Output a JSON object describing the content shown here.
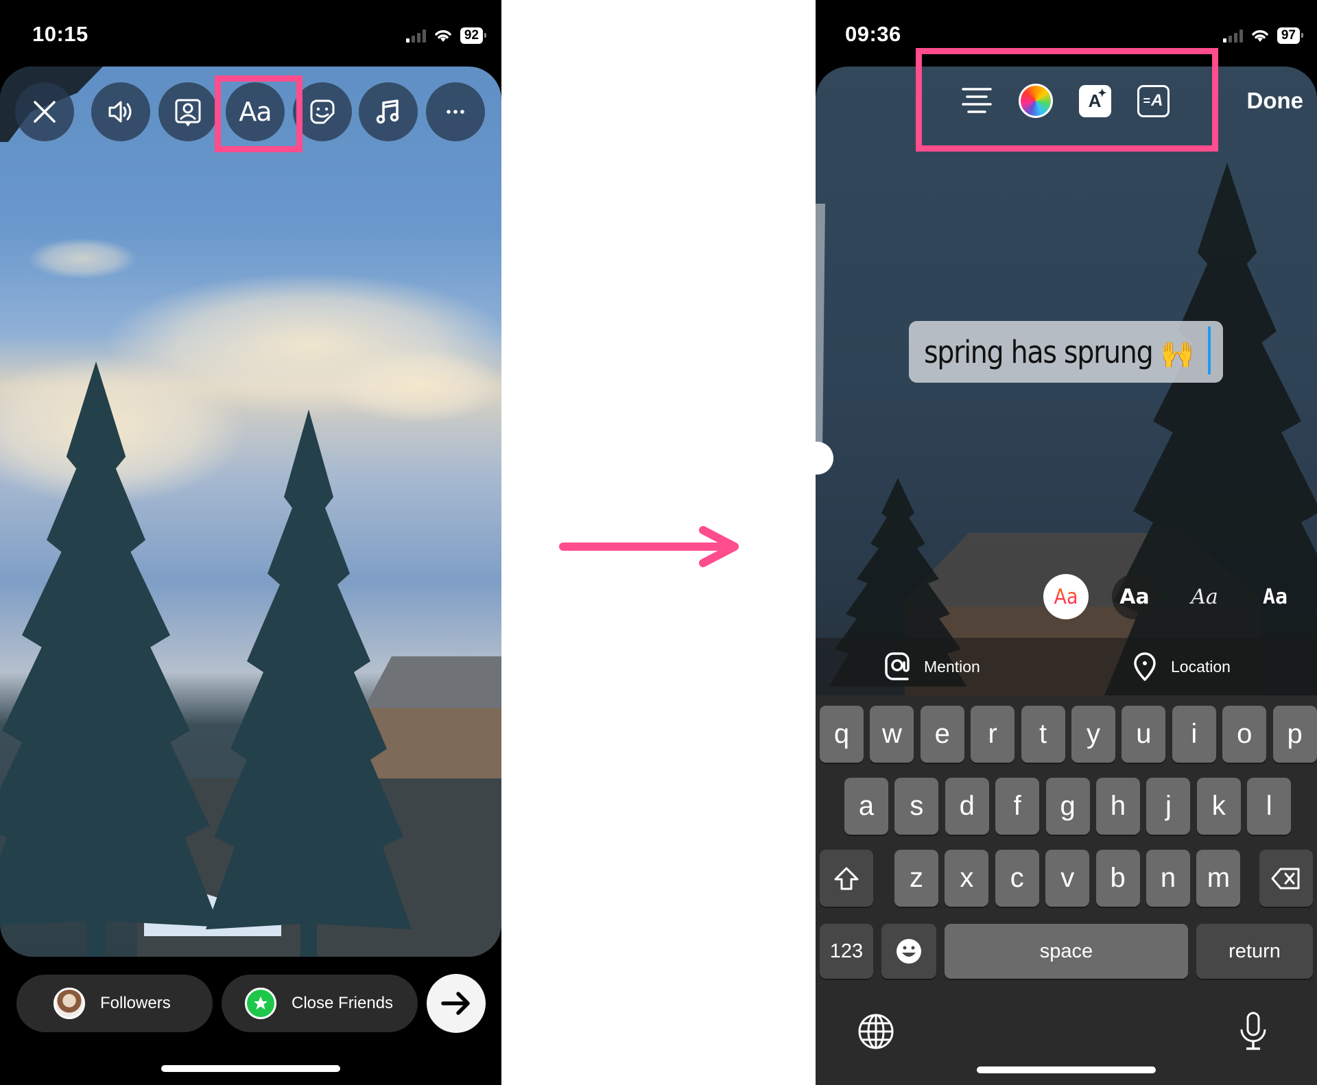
{
  "left_screen": {
    "status_bar": {
      "time": "10:15",
      "battery": "92"
    },
    "toolbar": {
      "buttons": [
        {
          "name": "close",
          "icon": "close-icon"
        },
        {
          "name": "sound",
          "icon": "speaker-icon"
        },
        {
          "name": "mention-person",
          "icon": "person-tag-icon"
        },
        {
          "name": "text",
          "icon": "text-aa-icon",
          "label": "Aa",
          "highlighted": true
        },
        {
          "name": "sticker",
          "icon": "sticker-icon"
        },
        {
          "name": "music",
          "icon": "music-note-icon"
        },
        {
          "name": "more",
          "icon": "more-dots-icon"
        }
      ]
    },
    "share_bar": {
      "followers_label": "Followers",
      "close_friends_label": "Close Friends",
      "next_icon": "arrow-right-icon"
    }
  },
  "transition_arrow": {
    "color": "#ff4d8d"
  },
  "right_screen": {
    "status_bar": {
      "time": "09:36",
      "battery": "97"
    },
    "text_tools": {
      "icons": [
        "align-center-icon",
        "color-wheel-icon",
        "text-effects-icon",
        "text-animation-icon"
      ],
      "effects_label": "A",
      "animation_label": "A",
      "done_label": "Done"
    },
    "story_text": {
      "value": "spring has sprung",
      "emoji": "🙌"
    },
    "font_styles": [
      {
        "label": "Aa",
        "style": "classic",
        "selected": true
      },
      {
        "label": "Aa",
        "style": "strong",
        "selected": false
      },
      {
        "label": "Aa",
        "style": "script",
        "selected": false
      },
      {
        "label": "Aa",
        "style": "typewriter",
        "selected": false
      }
    ],
    "suggestions": {
      "mention_label": "Mention",
      "location_label": "Location"
    },
    "keyboard": {
      "row1": [
        "q",
        "w",
        "e",
        "r",
        "t",
        "y",
        "u",
        "i",
        "o",
        "p"
      ],
      "row2": [
        "a",
        "s",
        "d",
        "f",
        "g",
        "h",
        "j",
        "k",
        "l"
      ],
      "row3": [
        "z",
        "x",
        "c",
        "v",
        "b",
        "n",
        "m"
      ],
      "numbers_label": "123",
      "space_label": "space",
      "return_label": "return"
    }
  },
  "highlight_color": "#ff4d8d"
}
